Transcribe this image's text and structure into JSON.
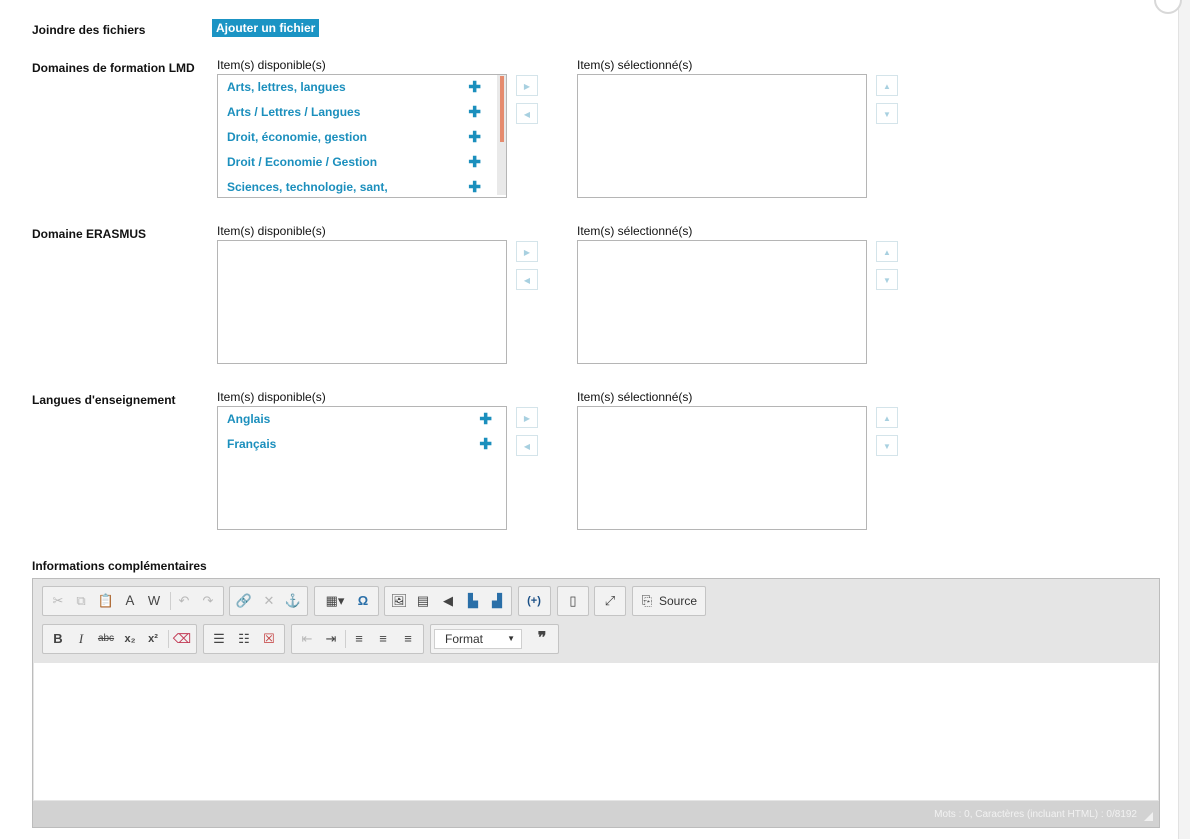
{
  "attach": {
    "label": "Joindre des fichiers",
    "button": "Ajouter un fichier"
  },
  "columns": {
    "available": "Item(s) disponible(s)",
    "selected": "Item(s) sélectionné(s)"
  },
  "sections": [
    {
      "label": "Domaines de formation LMD",
      "items": [
        "Arts, lettres, langues",
        "Arts / Lettres / Langues",
        "Droit, économie, gestion",
        "Droit / Economie / Gestion",
        "Sciences, technologie, sant,"
      ]
    },
    {
      "label": "Domaine ERASMUS",
      "items": []
    },
    {
      "label": "Langues d'enseignement",
      "items": [
        "Anglais",
        "Français"
      ]
    }
  ],
  "extra_info": {
    "label": "Informations complémentaires",
    "toolbar": {
      "source_label": "Source",
      "format_label": "Format"
    },
    "status": "Mots : 0, Caractères (incluant HTML) : 0/8192"
  },
  "icons": {
    "add": "plus-icon",
    "move_right": "arrow-right-icon",
    "move_left": "arrow-left-icon",
    "move_up": "arrow-up-icon",
    "move_down": "arrow-down-icon"
  },
  "colors": {
    "accent": "#1b94c4",
    "link": "#1b8fbd",
    "scroll_thumb": "#e58b6e"
  }
}
